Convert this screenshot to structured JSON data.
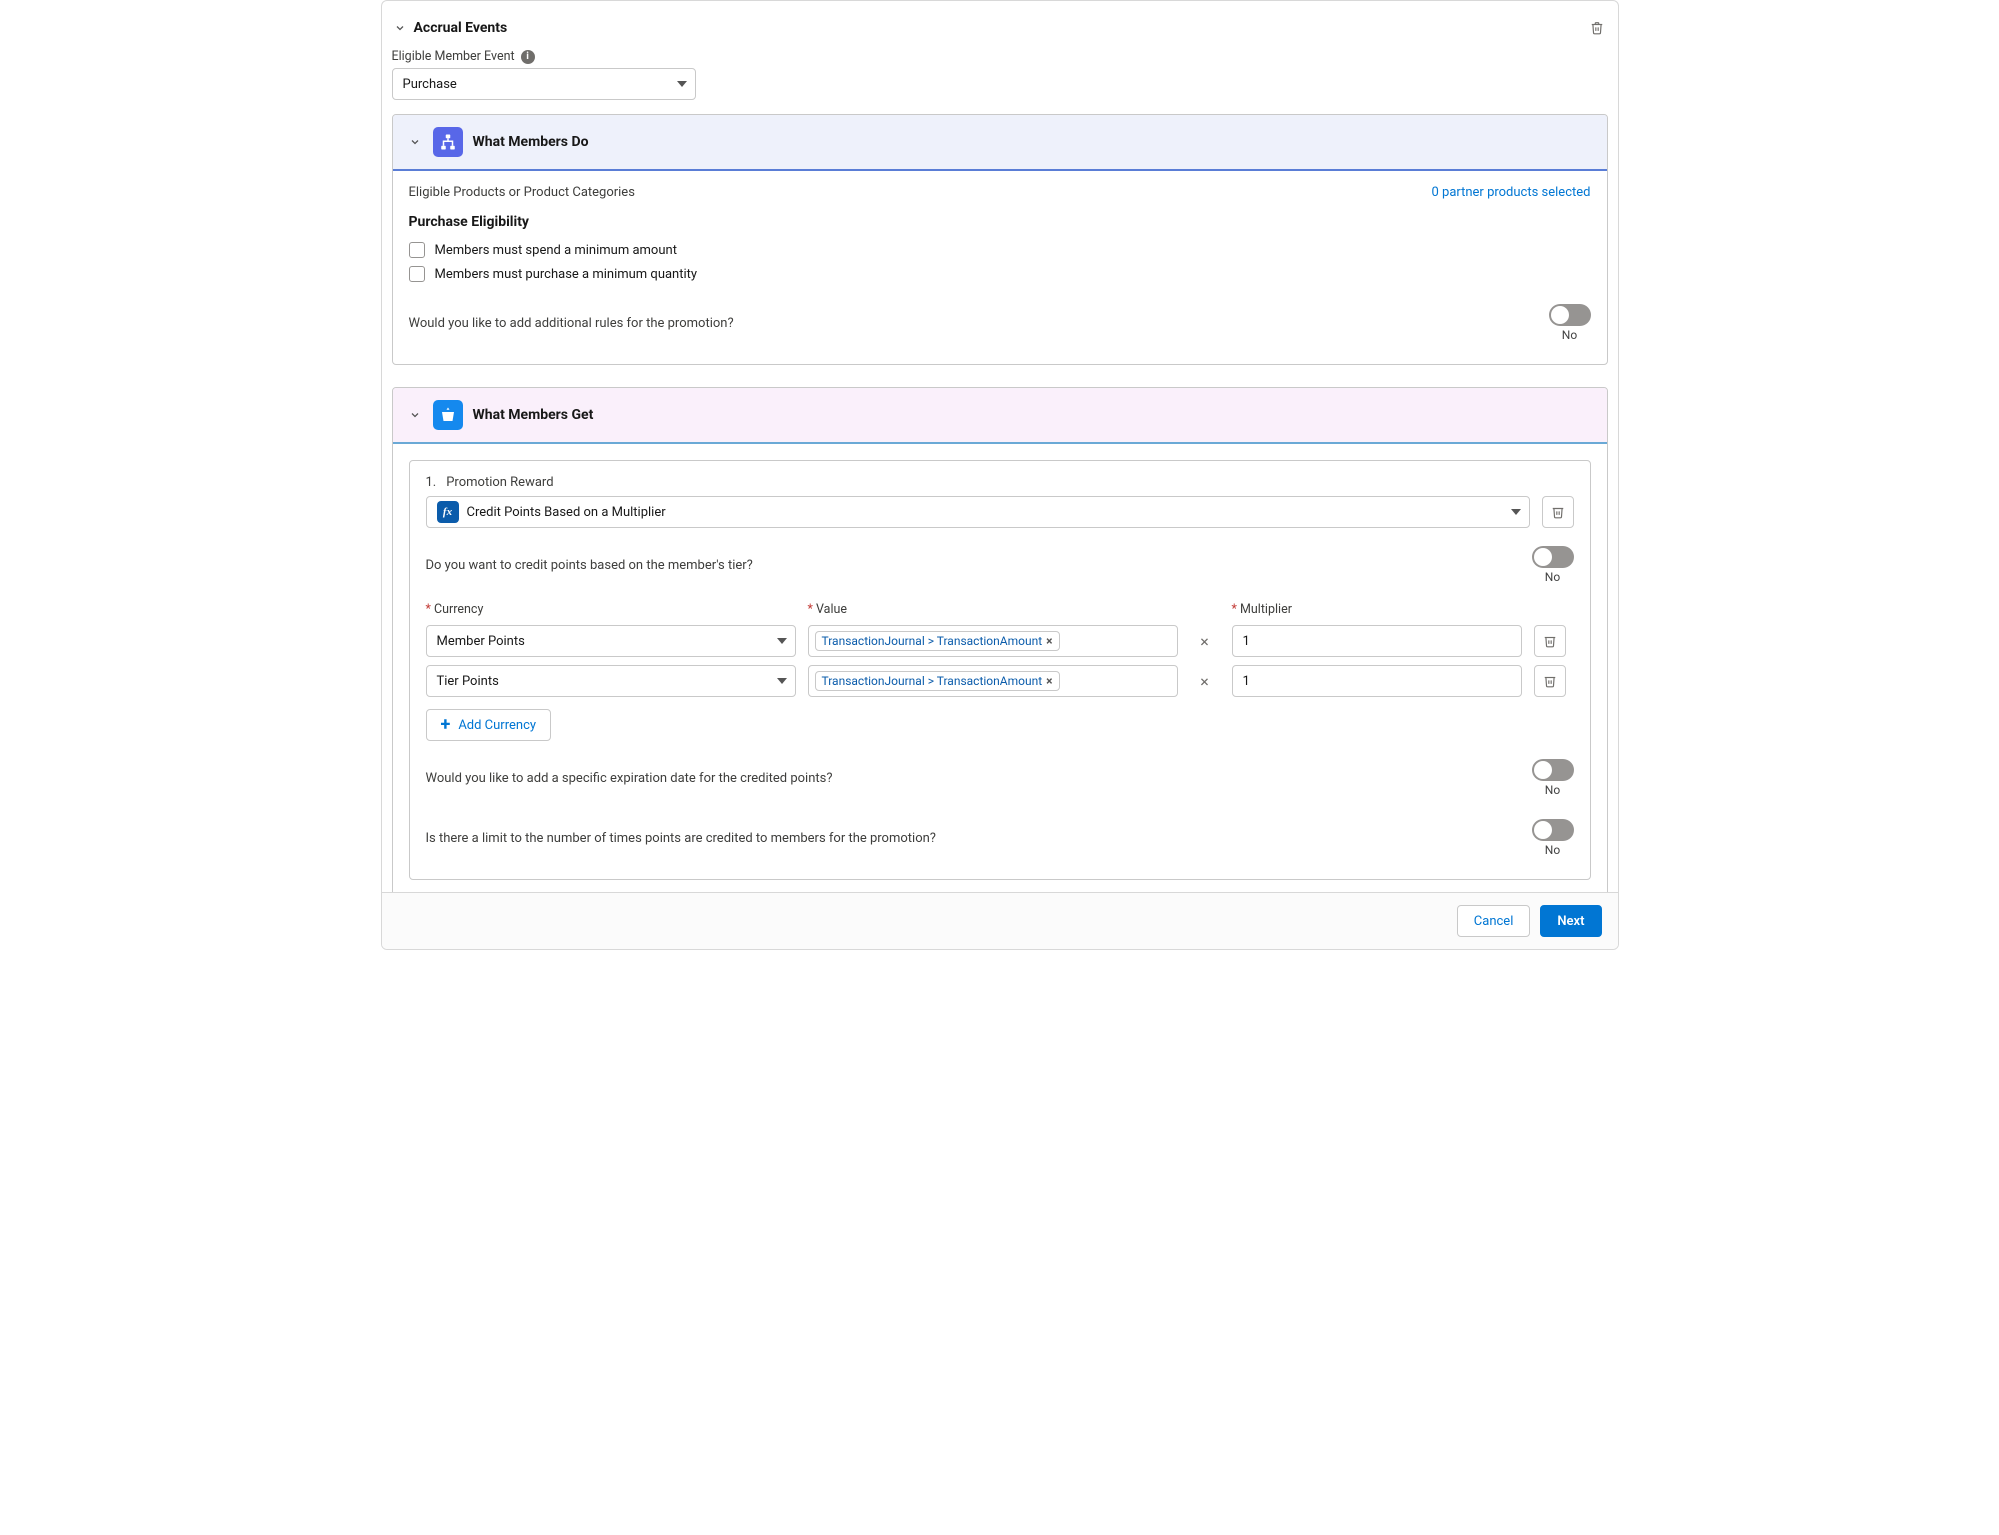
{
  "accrual": {
    "title": "Accrual Events",
    "eligible_event_label": "Eligible Member Event",
    "eligible_event_value": "Purchase"
  },
  "what_members_do": {
    "title": "What Members Do",
    "eligible_products_label": "Eligible Products or Product Categories",
    "partner_products_link": "0 partner products selected",
    "purchase_eligibility_title": "Purchase Eligibility",
    "checkbox_min_amount": "Members must spend a minimum amount",
    "checkbox_min_qty": "Members must purchase a minimum quantity",
    "additional_rules_question": "Would you like to add additional rules for the promotion?",
    "additional_rules_toggle": "No"
  },
  "what_members_get": {
    "title": "What Members Get",
    "reward_index": "1.",
    "reward_label": "Promotion Reward",
    "reward_select_value": "Credit Points Based on a Multiplier",
    "tier_question": "Do you want to credit points based on the member's tier?",
    "tier_toggle": "No",
    "headers": {
      "currency": "Currency",
      "value": "Value",
      "multiplier": "Multiplier"
    },
    "rows": [
      {
        "currency": "Member Points",
        "value_chip": "TransactionJournal > TransactionAmount",
        "multiplier": "1"
      },
      {
        "currency": "Tier Points",
        "value_chip": "TransactionJournal > TransactionAmount",
        "multiplier": "1"
      }
    ],
    "add_currency": "Add Currency",
    "expiration_question": "Would you like to add a specific expiration date for the credited points?",
    "expiration_toggle": "No",
    "limit_question": "Is there a limit to the number of times points are credited to members for the promotion?",
    "limit_toggle": "No"
  },
  "footer": {
    "cancel": "Cancel",
    "next": "Next"
  },
  "symbols": {
    "times": "×"
  }
}
